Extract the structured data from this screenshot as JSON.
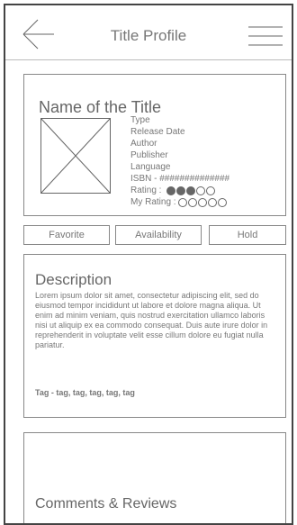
{
  "header": {
    "title": "Title Profile",
    "back_icon": "back-arrow-icon",
    "menu_icon": "hamburger-menu-icon"
  },
  "book": {
    "name": "Name of the Title",
    "cover_icon": "image-placeholder-icon",
    "fields": {
      "type": "Type",
      "release_date": "Release Date",
      "author": "Author",
      "publisher": "Publisher",
      "language": "Language",
      "isbn": "ISBN - ##############"
    },
    "rating_label": "Rating :",
    "rating_value": 3,
    "rating_max": 5,
    "my_rating_label": "My Rating :",
    "my_rating_value": 0,
    "my_rating_max": 5
  },
  "actions": {
    "favorite": "Favorite",
    "availability": "Availability",
    "hold": "Hold"
  },
  "description": {
    "title": "Description",
    "text": "Lorem ipsum dolor sit amet, consectetur adipiscing elit, sed do eiusmod tempor incididunt ut labore et dolore magna aliqua. Ut enim ad minim veniam, quis nostrud exercitation ullamco laboris nisi ut aliquip ex ea commodo consequat. Duis aute irure dolor in reprehenderit in voluptate velit esse cillum dolore eu fugiat nulla pariatur.",
    "tags": "Tag - tag, tag, tag, tag, tag"
  },
  "comments": {
    "title": "Comments & Reviews"
  }
}
